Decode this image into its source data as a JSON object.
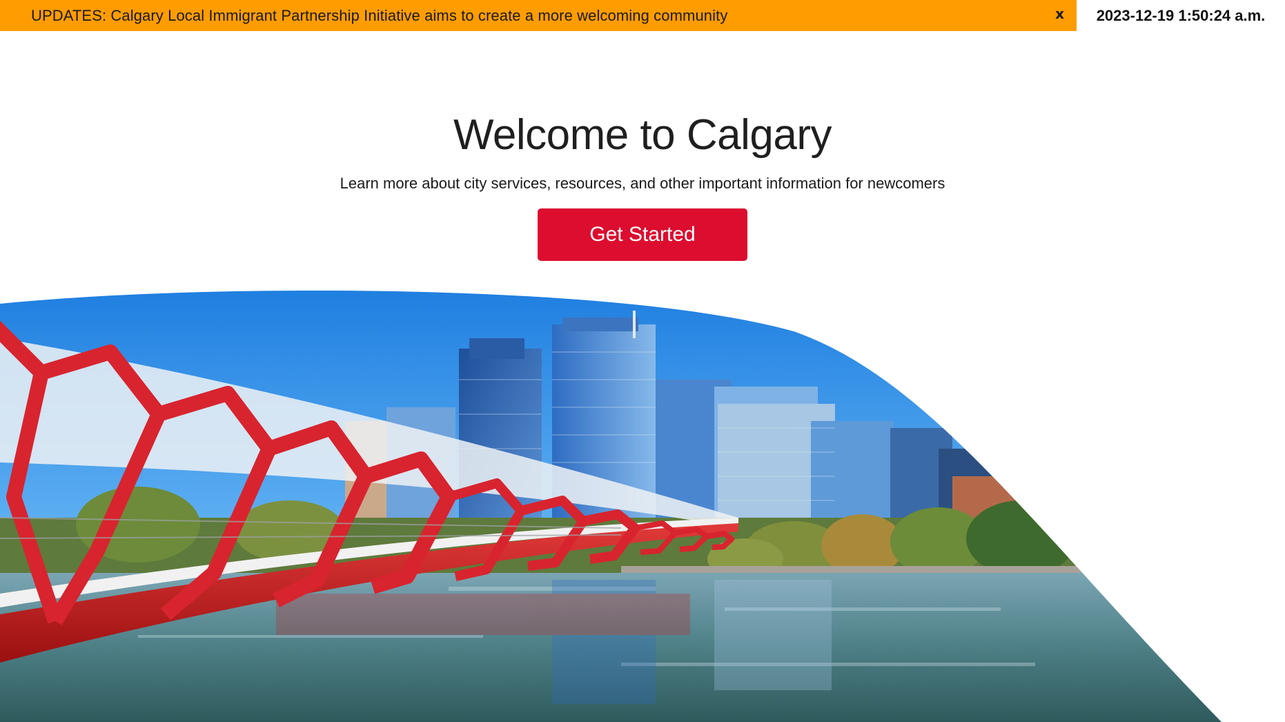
{
  "banner": {
    "text": "UPDATES: Calgary Local Immigrant Partnership Initiative aims to create a more welcoming community",
    "close_label": "x",
    "background": "#ff9c00"
  },
  "clock": {
    "datetime": "2023-12-19 1:50:24 a.m."
  },
  "hero": {
    "title": "Welcome to Calgary",
    "subtitle": "Learn more about city services, resources, and other important information for newcomers",
    "cta_label": "Get Started",
    "cta_color": "#dc0d2f"
  },
  "photo": {
    "subject": "Peace Bridge and downtown Calgary skyline over the Bow River"
  }
}
